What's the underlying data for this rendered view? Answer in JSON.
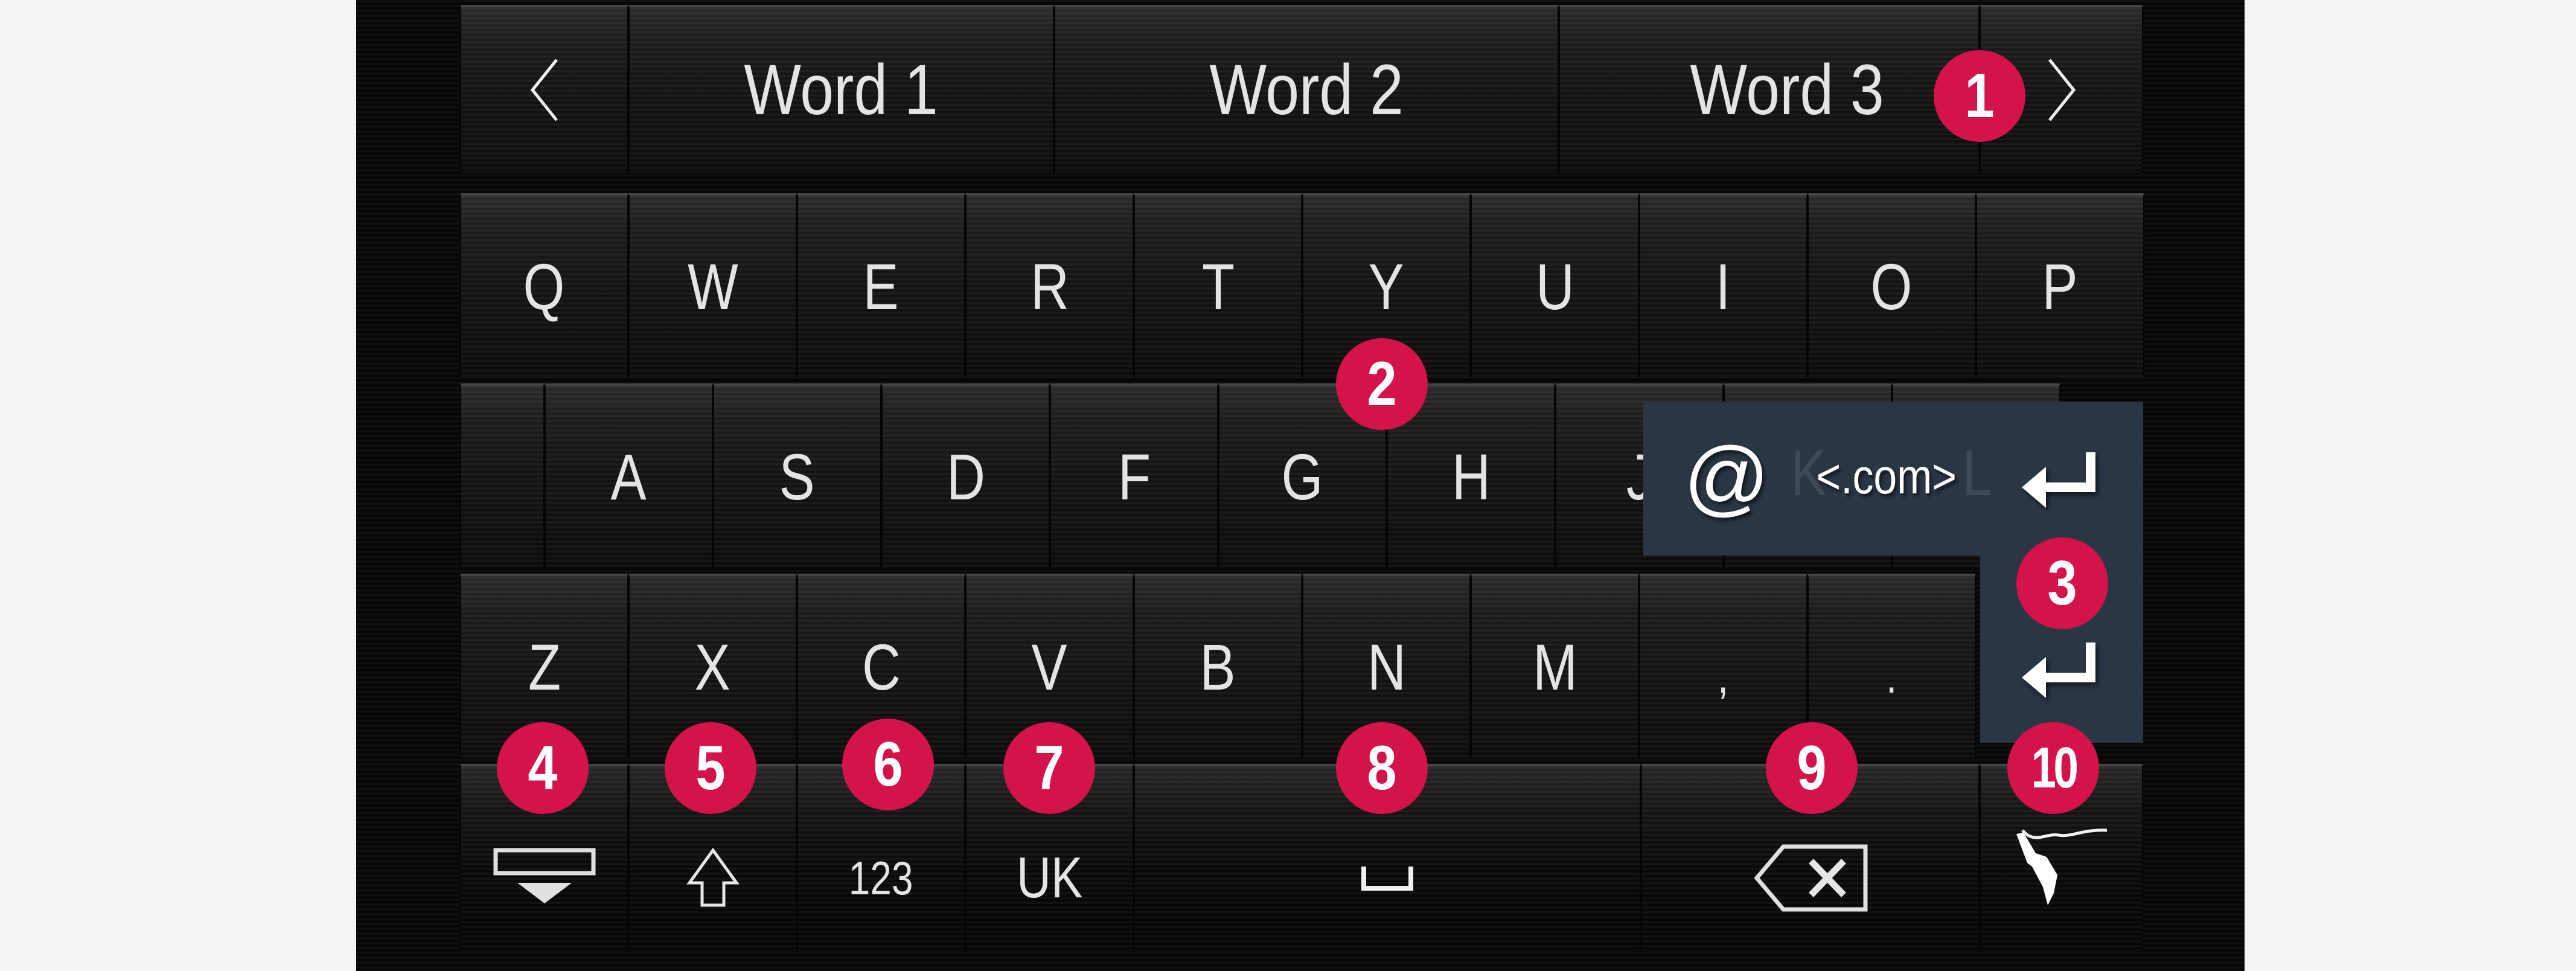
{
  "keyboard": {
    "suggestions": {
      "prev_icon": "chevron-left-icon",
      "next_icon": "chevron-right-icon",
      "words": [
        "Word 1",
        "Word 2",
        "Word 3"
      ]
    },
    "rows": {
      "row1": [
        "Q",
        "W",
        "E",
        "R",
        "T",
        "Y",
        "U",
        "I",
        "O",
        "P"
      ],
      "row2": [
        "A",
        "S",
        "D",
        "F",
        "G",
        "H",
        "J",
        "K",
        "L"
      ],
      "row3": [
        "Z",
        "X",
        "C",
        "V",
        "B",
        "N",
        "M",
        ",",
        "."
      ]
    },
    "bottom_row": {
      "hide_keyboard_icon": "hide-keyboard-icon",
      "shift_icon": "shift-icon",
      "numbers_label": "123",
      "language_label": "UK",
      "space_icon": "space-icon",
      "backspace_icon": "backspace-icon",
      "handwriting_icon": "handwriting-icon"
    },
    "popup": {
      "at_label": "@",
      "dotcom_label": "<.com>",
      "enter_icon": "enter-icon"
    },
    "enter_key_icon": "enter-icon"
  },
  "markers": [
    "1",
    "2",
    "3",
    "4",
    "5",
    "6",
    "7",
    "8",
    "9",
    "10"
  ],
  "colors": {
    "marker": "#d4134a",
    "popup_bg": "#2b3645",
    "key_text": "#e4e4e4",
    "page_bg": "#f4f4f4"
  }
}
